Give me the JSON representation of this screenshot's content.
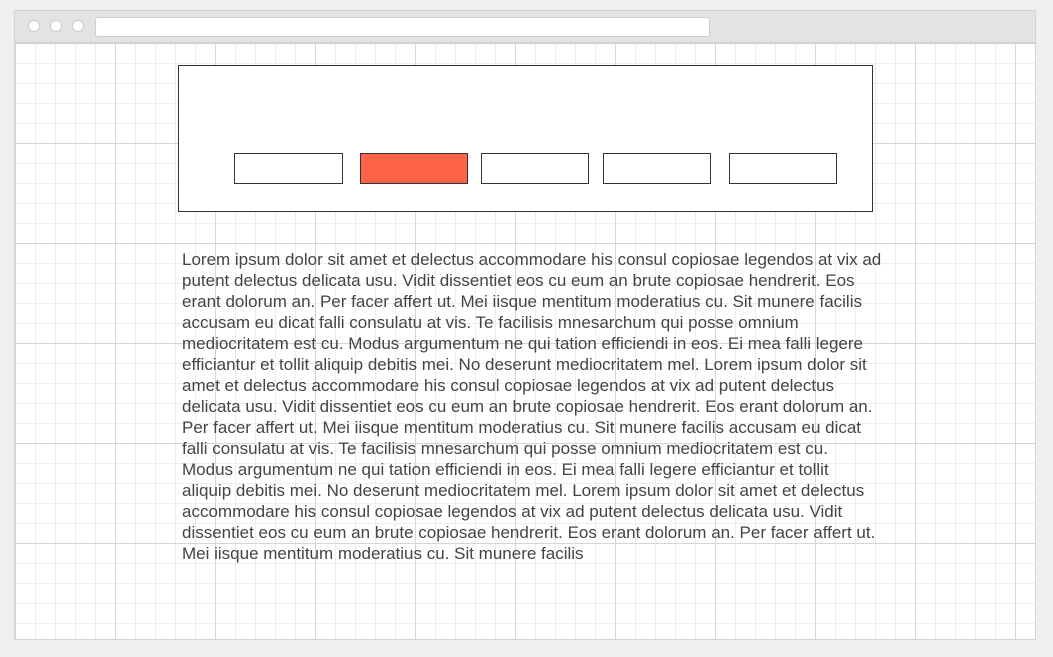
{
  "window": {
    "address_bar": {
      "value": ""
    }
  },
  "hero": {
    "tabs": [
      {
        "label": "",
        "active": false
      },
      {
        "label": "",
        "active": true
      },
      {
        "label": "",
        "active": false
      },
      {
        "label": "",
        "active": false
      },
      {
        "label": "",
        "active": false
      }
    ],
    "accent_color": "#ff634a"
  },
  "main": {
    "paragraph": "Lorem ipsum dolor sit amet et delectus accommodare his consul copiosae legendos at vix ad putent delectus delicata usu. Vidit dissentiet eos cu eum an brute copiosae hendrerit. Eos erant dolorum an. Per facer affert ut. Mei iisque mentitum moderatius cu. Sit munere facilis accusam eu dicat falli consulatu at vis. Te facilisis mnesarchum qui posse omnium mediocritatem est cu. Modus argumentum ne qui tation efficiendi in eos. Ei mea falli legere efficiantur et tollit aliquip debitis mei. No deserunt mediocritatem mel. Lorem ipsum dolor sit amet et delectus accommodare his consul copiosae legendos at vix ad putent delectus delicata usu. Vidit dissentiet eos cu eum an brute copiosae hendrerit. Eos erant dolorum an. Per facer affert ut. Mei iisque mentitum moderatius cu. Sit munere facilis accusam eu dicat falli consulatu at vis. Te facilisis mnesarchum qui posse omnium mediocritatem est cu. Modus argumentum ne qui tation efficiendi in eos. Ei mea falli legere efficiantur et tollit aliquip debitis mei. No deserunt mediocritatem mel. Lorem ipsum dolor sit amet et delectus accommodare his consul copiosae legendos at vix ad putent delectus delicata usu. Vidit dissentiet eos cu eum an brute copiosae hendrerit. Eos erant dolorum an. Per facer affert ut. Mei iisque mentitum moderatius cu. Sit munere facilis"
  }
}
